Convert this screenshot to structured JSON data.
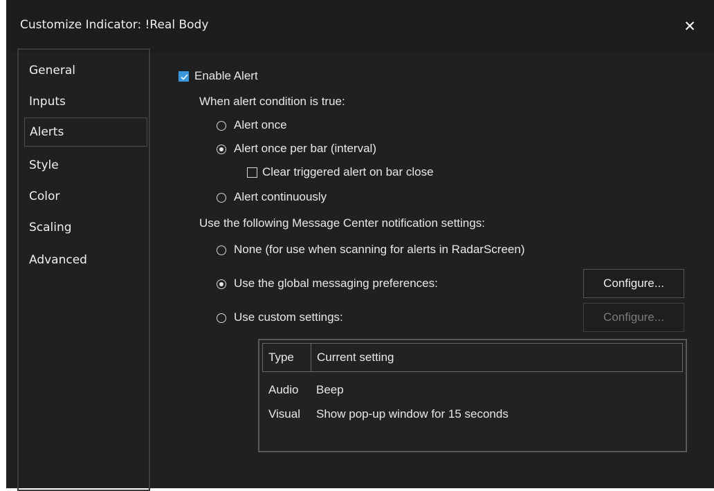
{
  "window": {
    "title": "Customize Indicator: !Real Body",
    "close_glyph": "✕"
  },
  "sidebar": {
    "items": [
      {
        "label": "General",
        "selected": false
      },
      {
        "label": "Inputs",
        "selected": false
      },
      {
        "label": "Alerts",
        "selected": true
      },
      {
        "label": "Style",
        "selected": false
      },
      {
        "label": "Color",
        "selected": false
      },
      {
        "label": "Scaling",
        "selected": false
      },
      {
        "label": "Advanced",
        "selected": false
      }
    ]
  },
  "alerts": {
    "enable_alert": {
      "label": "Enable Alert",
      "checked": true
    },
    "condition_heading": "When alert condition is true:",
    "frequency_options": [
      {
        "label": "Alert once",
        "selected": false
      },
      {
        "label": "Alert once per bar (interval)",
        "selected": true
      },
      {
        "label": "Alert continuously",
        "selected": false
      }
    ],
    "clear_triggered": {
      "label": "Clear triggered alert on bar close",
      "checked": false
    },
    "notification_heading": "Use the following Message Center notification settings:",
    "notification_options": [
      {
        "label": "None (for use when scanning for alerts in RadarScreen)",
        "selected": false
      },
      {
        "label": "Use the global messaging preferences:",
        "selected": true
      },
      {
        "label": "Use custom settings:",
        "selected": false
      }
    ],
    "configure_global": {
      "label": "Configure...",
      "enabled": true
    },
    "configure_custom": {
      "label": "Configure...",
      "enabled": false
    },
    "settings_table": {
      "headers": [
        "Type",
        "Current setting"
      ],
      "rows": [
        [
          "Audio",
          "Beep"
        ],
        [
          "Visual",
          "Show pop-up window for 15 seconds"
        ]
      ]
    }
  },
  "colors": {
    "window_bg": "#202020",
    "accent_check": "#3a96dd",
    "text": "#e8e8e8"
  },
  "icons": [
    "close-icon",
    "checkmark-icon",
    "radio-icon"
  ]
}
